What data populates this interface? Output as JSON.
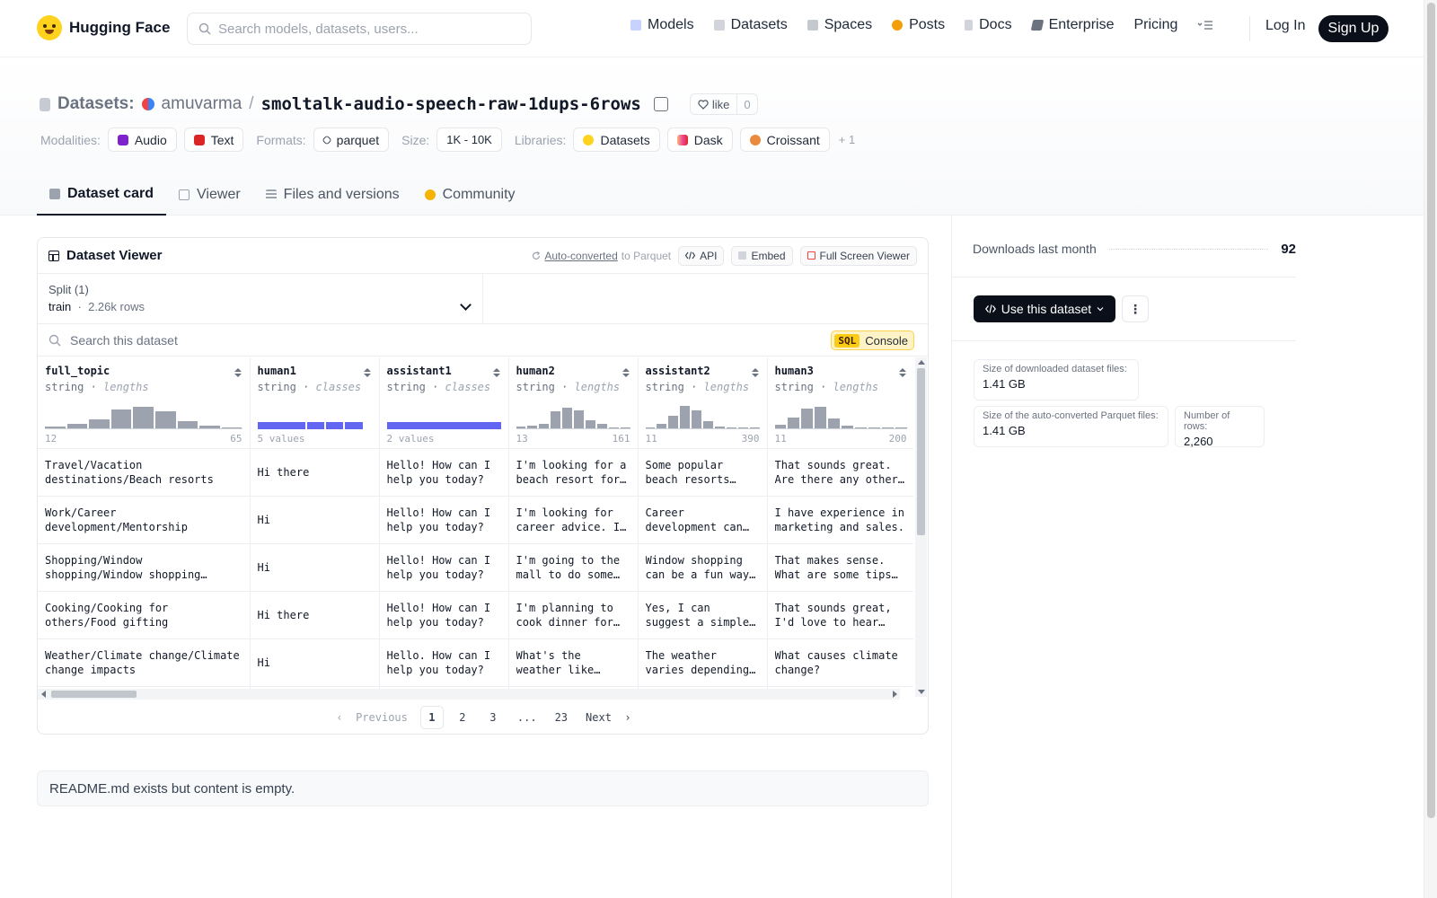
{
  "nav": {
    "brand": "Hugging Face",
    "search_placeholder": "Search models, datasets, users...",
    "links": [
      {
        "label": "Models",
        "icon": "cube-icon",
        "color": "#a5b4fc"
      },
      {
        "label": "Datasets",
        "icon": "database-icon",
        "color": "#d1d5db"
      },
      {
        "label": "Spaces",
        "icon": "grid-icon",
        "color": "#9ca3af"
      },
      {
        "label": "Posts",
        "icon": "chat-bubble-icon",
        "color": "#f59e0b"
      },
      {
        "label": "Docs",
        "icon": "doc-icon",
        "color": "#d1d5db"
      },
      {
        "label": "Enterprise",
        "icon": "enterprise-icon",
        "color": "#6b7280"
      },
      {
        "label": "Pricing",
        "icon": "",
        "color": ""
      }
    ],
    "login": "Log In",
    "signup": "Sign Up"
  },
  "header": {
    "section_label": "Datasets:",
    "owner": "amuvarma",
    "repo": "smoltalk-audio-speech-raw-1dups-6rows",
    "like_label": "like",
    "like_count": "0",
    "modalities_label": "Modalities:",
    "modalities": [
      "Audio",
      "Text"
    ],
    "formats_label": "Formats:",
    "formats": [
      "parquet"
    ],
    "size_label": "Size:",
    "size": "1K - 10K",
    "libraries_label": "Libraries:",
    "libraries": [
      "Datasets",
      "Dask",
      "Croissant"
    ],
    "libraries_more": "+ 1"
  },
  "tabs": [
    {
      "label": "Dataset card",
      "active": true
    },
    {
      "label": "Viewer",
      "active": false
    },
    {
      "label": "Files and versions",
      "active": false
    },
    {
      "label": "Community",
      "active": false
    }
  ],
  "viewer": {
    "title": "Dataset Viewer",
    "auto_converted": "Auto-converted",
    "to_parquet": "to Parquet",
    "api_label": "API",
    "embed_label": "Embed",
    "fullscreen_label": "Full Screen Viewer",
    "split_label": "Split (1)",
    "split_value": "train",
    "split_rows": "2.26k rows",
    "search_placeholder": "Search this dataset",
    "sql_badge": "SQL",
    "sql_label": "Console",
    "columns": [
      {
        "name": "full_topic",
        "type": "string",
        "kind": "lengths",
        "hist": [
          0.06,
          0.18,
          0.4,
          0.82,
          0.92,
          0.72,
          0.3,
          0.12,
          0.04
        ],
        "min": "12",
        "max": "65"
      },
      {
        "name": "human1",
        "type": "string",
        "kind": "classes",
        "classes_text": "5 values",
        "class_parts": [
          0.44,
          0.16,
          0.16,
          0.16
        ]
      },
      {
        "name": "assistant1",
        "type": "string",
        "kind": "classes",
        "classes_text": "2 values",
        "class_parts": [
          1.0
        ]
      },
      {
        "name": "human2",
        "type": "string",
        "kind": "lengths",
        "hist": [
          0.06,
          0.1,
          0.2,
          0.72,
          0.9,
          0.75,
          0.35,
          0.18,
          0.05,
          0.03
        ],
        "min": "13",
        "max": "161"
      },
      {
        "name": "assistant2",
        "type": "string",
        "kind": "lengths",
        "hist": [
          0.05,
          0.18,
          0.55,
          0.95,
          0.75,
          0.3,
          0.08,
          0.04,
          0.03,
          0.02
        ],
        "min": "11",
        "max": "390"
      },
      {
        "name": "human3",
        "type": "string",
        "kind": "lengths",
        "hist": [
          0.15,
          0.45,
          0.85,
          0.92,
          0.42,
          0.1,
          0.05,
          0.04,
          0.03,
          0.02
        ],
        "min": "11",
        "max": "200"
      }
    ],
    "rows": [
      [
        "Travel/Vacation destinations/Beach resorts",
        "Hi there",
        "Hello! How can I help you today?",
        "I'm looking for a beach resort for my vacation.",
        "Some popular beach resorts include Maui in Hawaii.",
        "That sounds great. Are there any other options?"
      ],
      [
        "Work/Career development/Mentorship",
        "Hi",
        "Hello! How can I help you today?",
        "I'm looking for career advice. I need a mentor.",
        "Career development can be challenging at times.",
        "I have experience in marketing and sales."
      ],
      [
        "Shopping/Window shopping/Window shopping etiquette",
        "Hi",
        "Hello! How can I help you today?",
        "I'm going to the mall to do some window shopping.",
        "Window shopping can be a fun way to spend time.",
        "That makes sense. What are some tips to follow?"
      ],
      [
        "Cooking/Cooking for others/Food gifting",
        "Hi there",
        "Hello! How can I help you today?",
        "I'm planning to cook dinner for my friends.",
        "Yes, I can suggest a simple pasta dish.",
        "That sounds great, I'd love to hear more."
      ],
      [
        "Weather/Climate change/Climate change impacts",
        "Hi",
        "Hello. How can I help you today?",
        "What's the weather like today?",
        "The weather varies depending on your location.",
        "What causes climate change?"
      ]
    ],
    "pager": {
      "prev": "Previous",
      "pages": [
        "1",
        "2",
        "3",
        "...",
        "23"
      ],
      "next": "Next",
      "current": "1"
    }
  },
  "readme": "README.md exists but content is empty.",
  "sidebar": {
    "downloads_label": "Downloads last month",
    "downloads_value": "92",
    "use_button": "Use this dataset",
    "stats": [
      {
        "label": "Size of downloaded dataset files:",
        "value": "1.41 GB"
      },
      {
        "label": "Size of the auto-converted Parquet files:",
        "value": "1.41 GB"
      },
      {
        "label": "Number of rows:",
        "value": "2,260"
      }
    ]
  }
}
